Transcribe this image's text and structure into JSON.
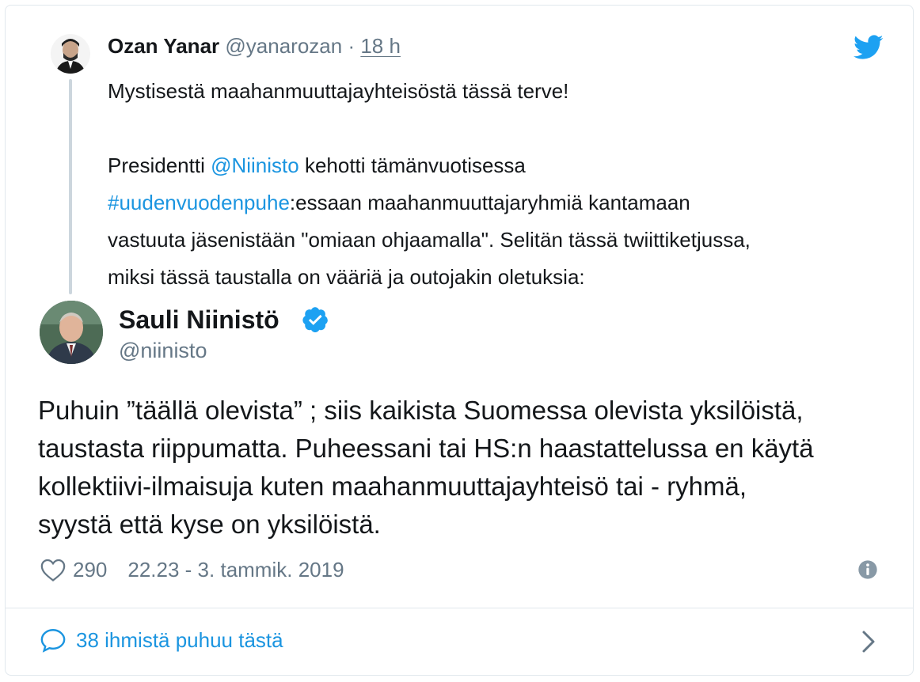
{
  "parent_tweet": {
    "author_name": "Ozan Yanar",
    "author_handle": "@yanarozan",
    "separator": "·",
    "time": "18 h",
    "line1": "Mystisestä maahanmuuttajayhteisöstä tässä terve!",
    "p2_start": "Presidentti ",
    "mention": "@Niinisto",
    "p2_mid": " kehotti tämänvuotisessa",
    "hashtag": "#uudenvuodenpuhe",
    "p2_after_hashtag": ":essaan maahanmuuttajaryhmiä kantamaan",
    "p2_line3": "vastuuta jäsenistään \"omiaan ohjaamalla\". Selitän tässä twiittiketjussa,",
    "p2_line4": "miksi tässä taustalla on vääriä ja outojakin oletuksia:"
  },
  "main_tweet": {
    "author_name": "Sauli Niinistö",
    "author_handle": "@niinisto",
    "text_lines": [
      "Puhuin  ”täällä olevista” ; siis kaikista Suomessa olevista yksilöistä,",
      "taustasta riippumatta. Puheessani tai HS:n haastattelussa en käytä",
      "kollektiivi-ilmaisuja kuten maahanmuuttajayhteisö tai - ryhmä,",
      "syystä että kyse on yksilöistä."
    ],
    "likes": "290",
    "timestamp": "22.23 - 3. tammik. 2019"
  },
  "footer": {
    "conversation_label": "38 ihmistä puhuu tästä"
  },
  "icons": {
    "brand": "twitter-bird-icon",
    "verified": "verified-badge-icon",
    "like": "heart-icon",
    "info": "info-icon",
    "reply": "speech-bubble-icon",
    "more": "chevron-right-icon"
  },
  "colors": {
    "link": "#1b95e0",
    "twitter_blue": "#1da1f2",
    "secondary_text": "#657786",
    "border": "#e1e8ed"
  }
}
